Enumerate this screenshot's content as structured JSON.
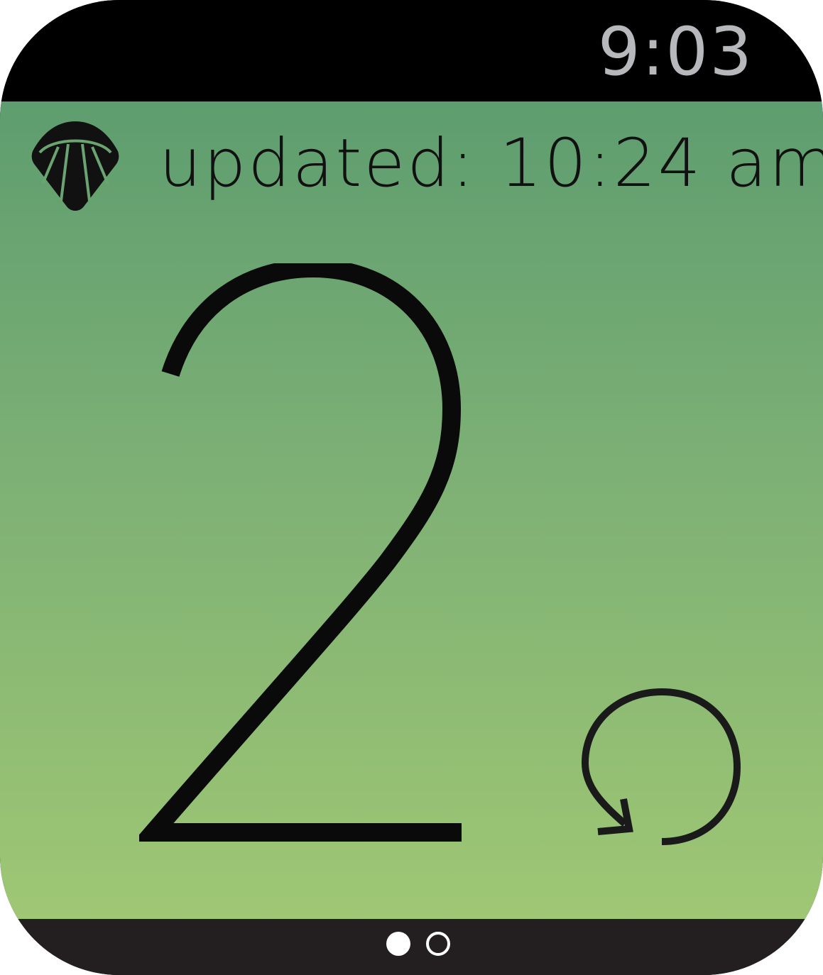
{
  "status_bar": {
    "time": "9:03"
  },
  "header": {
    "icon": "shell-logo-icon",
    "updated_text": "updated: 10:24 am"
  },
  "main": {
    "value": "2"
  },
  "actions": {
    "refresh_icon": "refresh-icon"
  },
  "pager": {
    "pages": 2,
    "active_page": 1
  },
  "colors": {
    "gradient_top": "#5e9d6f",
    "gradient_bottom": "#9fc774",
    "clock": "#b6b8bb",
    "text": "#111111"
  }
}
